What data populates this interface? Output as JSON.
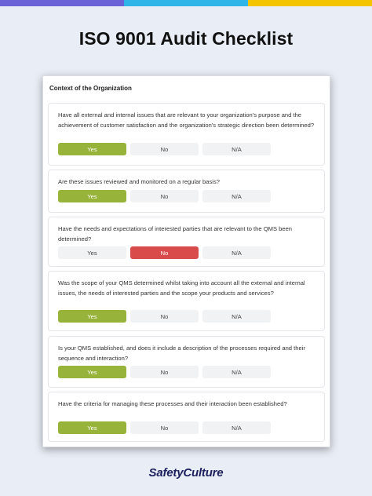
{
  "header": {
    "title": "ISO 9001 Audit Checklist",
    "bar_colors": [
      "#6b62d8",
      "#2fb5e8",
      "#f5c400"
    ]
  },
  "card": {
    "section_title": "Context of the Organization",
    "questions": [
      {
        "text": "Have all external and internal issues that are relevant to your organization's purpose and the achievement of customer satisfaction and the organization's strategic direction been determined?",
        "options": [
          "Yes",
          "No",
          "N/A"
        ],
        "selected": "Yes"
      },
      {
        "text": "Are these issues reviewed and monitored on a regular basis?",
        "options": [
          "Yes",
          "No",
          "N/A"
        ],
        "selected": "Yes"
      },
      {
        "text": "Have the needs and expectations of interested parties that are relevant to the QMS been determined?",
        "options": [
          "Yes",
          "No",
          "N/A"
        ],
        "selected": "No"
      },
      {
        "text": "Was the scope of your QMS determined whilst taking into account all the external and internal issues, the needs of interested parties and the scope your products and services?",
        "options": [
          "Yes",
          "No",
          "N/A"
        ],
        "selected": "Yes"
      },
      {
        "text": "Is your QMS established, and does it include a description of the processes required and their sequence and interaction?",
        "options": [
          "Yes",
          "No",
          "N/A"
        ],
        "selected": "Yes"
      },
      {
        "text": "Have the criteria for managing these processes and their interaction been established?",
        "options": [
          "Yes",
          "No",
          "N/A"
        ],
        "selected": "Yes"
      }
    ]
  },
  "colors": {
    "yes_selected": "#98b33a",
    "no_selected": "#d94b4b",
    "unselected": "#f1f2f4"
  },
  "footer": {
    "logo": "SafetyCulture"
  }
}
